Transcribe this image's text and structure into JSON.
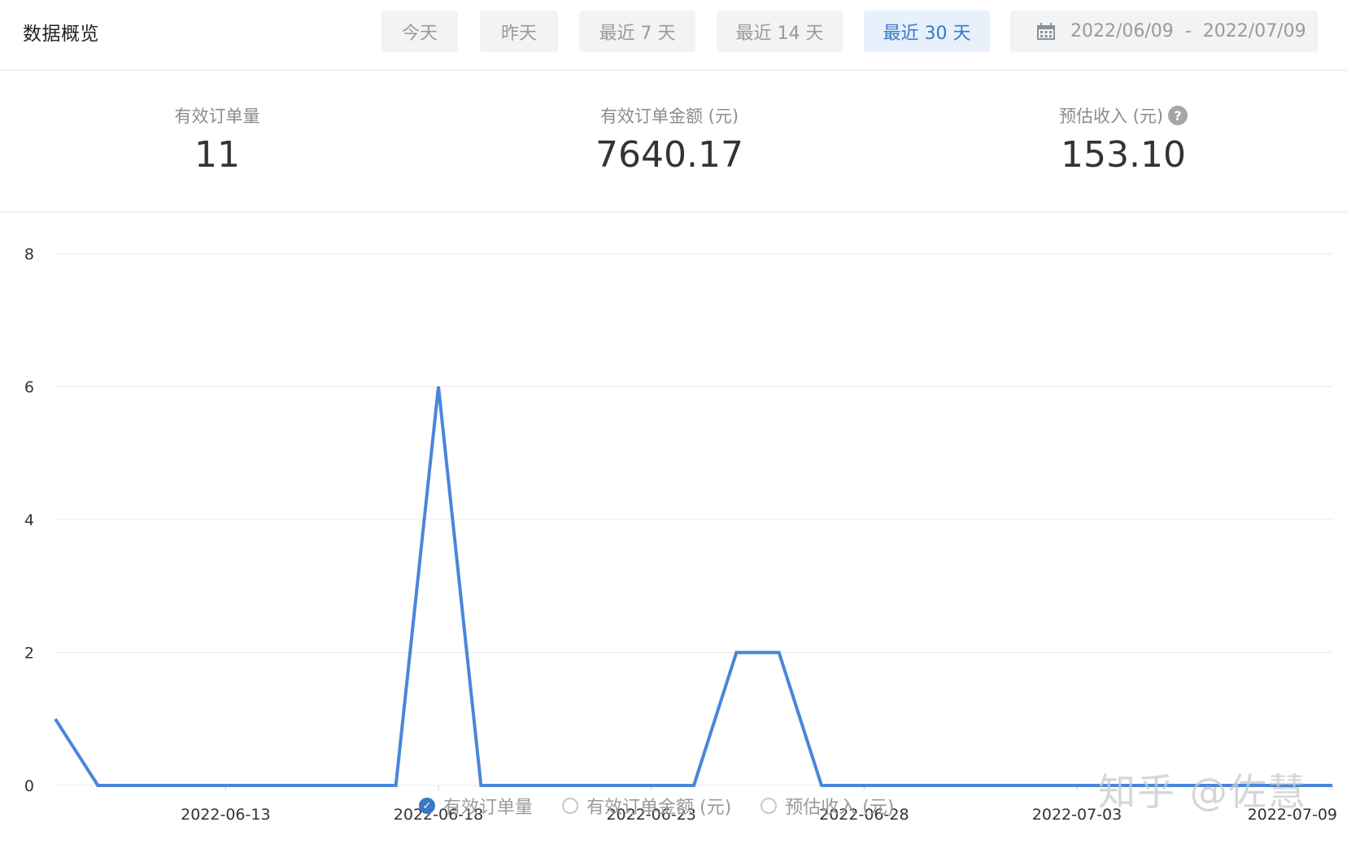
{
  "header": {
    "title": "数据概览",
    "range_buttons": [
      {
        "label": "今天",
        "active": false
      },
      {
        "label": "昨天",
        "active": false
      },
      {
        "label": "最近 7 天",
        "active": false
      },
      {
        "label": "最近 14 天",
        "active": false
      },
      {
        "label": "最近 30 天",
        "active": true
      }
    ],
    "date_start": "2022/06/09",
    "date_sep": "-",
    "date_end": "2022/07/09",
    "date_icon": "calendar-icon"
  },
  "metrics": [
    {
      "label": "有效订单量",
      "value": "11"
    },
    {
      "label": "有效订单金额 (元)",
      "value": "7640.17"
    },
    {
      "label": "预估收入 (元)",
      "value": "153.10",
      "help_icon": "?"
    }
  ],
  "legend": [
    {
      "label": "有效订单量",
      "checked": true
    },
    {
      "label": "有效订单金额 (元)",
      "checked": false
    },
    {
      "label": "预估收入 (元)",
      "checked": false
    }
  ],
  "watermark": "知乎 @佐慧",
  "colors": {
    "accent": "#3a78c9",
    "line": "#4a86d9",
    "grid": "#e8e8e8"
  },
  "chart_data": {
    "type": "line",
    "x": [
      "2022-06-09",
      "2022-06-10",
      "2022-06-11",
      "2022-06-12",
      "2022-06-13",
      "2022-06-14",
      "2022-06-15",
      "2022-06-16",
      "2022-06-17",
      "2022-06-18",
      "2022-06-19",
      "2022-06-20",
      "2022-06-21",
      "2022-06-22",
      "2022-06-23",
      "2022-06-24",
      "2022-06-25",
      "2022-06-26",
      "2022-06-27",
      "2022-06-28",
      "2022-06-29",
      "2022-06-30",
      "2022-07-01",
      "2022-07-02",
      "2022-07-03",
      "2022-07-04",
      "2022-07-05",
      "2022-07-06",
      "2022-07-07",
      "2022-07-08",
      "2022-07-09"
    ],
    "series": [
      {
        "name": "有效订单量",
        "values": [
          1,
          0,
          0,
          0,
          0,
          0,
          0,
          0,
          0,
          6,
          0,
          0,
          0,
          0,
          0,
          0,
          2,
          2,
          0,
          0,
          0,
          0,
          0,
          0,
          0,
          0,
          0,
          0,
          0,
          0,
          0
        ]
      }
    ],
    "x_tick_labels": [
      "2022-06-13",
      "2022-06-18",
      "2022-06-23",
      "2022-06-28",
      "2022-07-03",
      "2022-07-09"
    ],
    "y_ticks": [
      0,
      2,
      4,
      6,
      8
    ],
    "ylim": [
      0,
      8
    ],
    "grid": true,
    "legend_position": "bottom"
  }
}
